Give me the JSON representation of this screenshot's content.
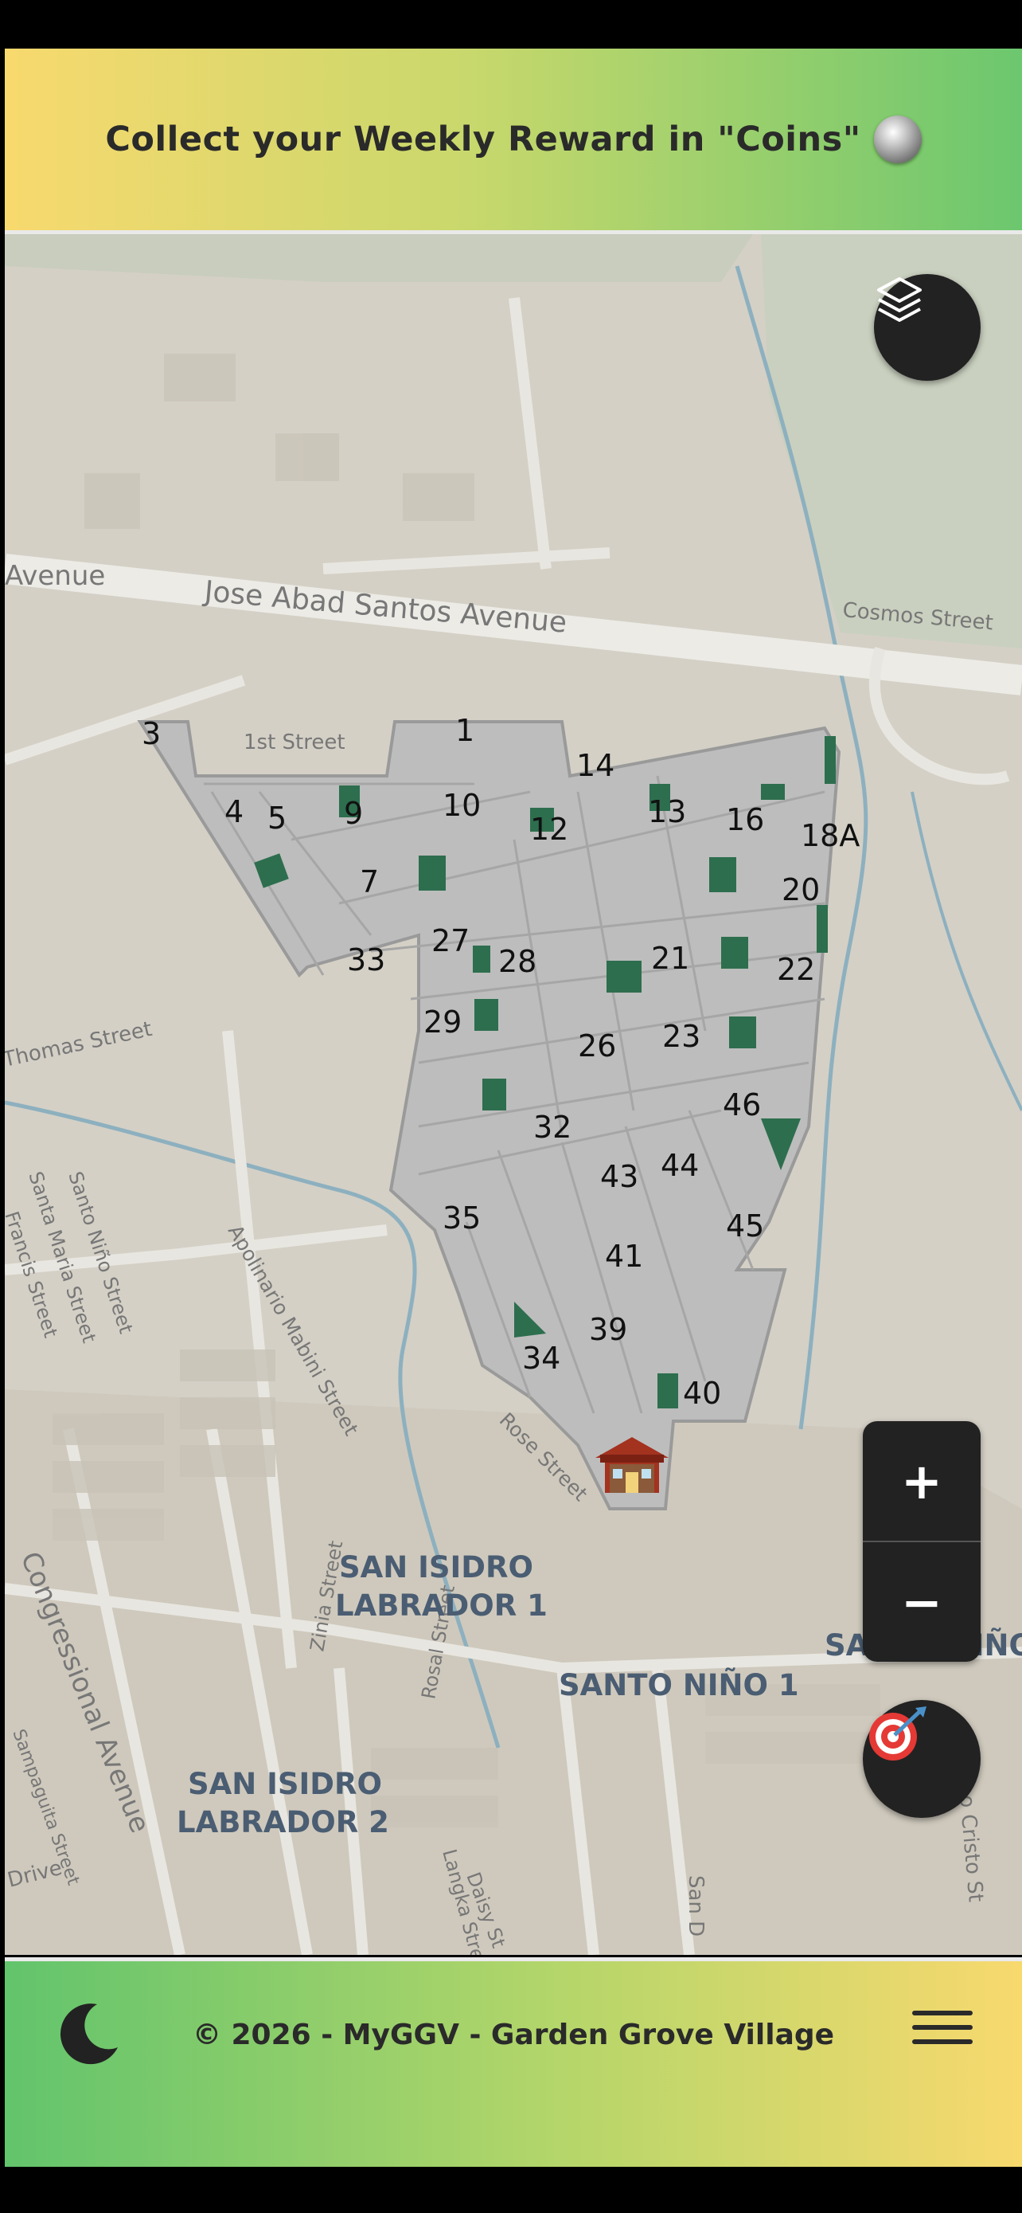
{
  "banner": {
    "text": "Collect your Weekly Reward in \"Coins\"",
    "icon": "coin-icon"
  },
  "map": {
    "roads": [
      {
        "label": "Jose Abad Santos Avenue"
      },
      {
        "label": "Avenue"
      },
      {
        "label": "Cosmos Street"
      },
      {
        "label": "1st Street"
      },
      {
        "label": "Thomas Street"
      },
      {
        "label": "Santo Niño Street"
      },
      {
        "label": "Santa Maria Street"
      },
      {
        "label": "Francis Street"
      },
      {
        "label": "Apolinario Mabini Street"
      },
      {
        "label": "Rose Street"
      },
      {
        "label": "Congressional Avenue"
      },
      {
        "label": "Zinia Street"
      },
      {
        "label": "Rosal Street"
      },
      {
        "label": "Langka Street"
      },
      {
        "label": "Daisy St"
      },
      {
        "label": "Sampaguita Street"
      },
      {
        "label": "San D"
      },
      {
        "label": "o Cristo St"
      },
      {
        "label": "Drive"
      }
    ],
    "places": [
      {
        "line1": "SAN ISIDRO",
        "line2": "LABRADOR 1"
      },
      {
        "line1": "SANTO NIÑO 1",
        "line2": ""
      },
      {
        "line1": "SAN ISIDRO",
        "line2": "LABRADOR 2"
      },
      {
        "line1": "SANTO NIÑO",
        "line2": ""
      }
    ],
    "lots": [
      "3",
      "1",
      "14",
      "4",
      "5",
      "9",
      "10",
      "12",
      "13",
      "16",
      "18A",
      "7",
      "20",
      "27",
      "33",
      "28",
      "21",
      "22",
      "29",
      "26",
      "23",
      "32",
      "46",
      "43",
      "44",
      "35",
      "45",
      "41",
      "39",
      "34",
      "40"
    ],
    "entrance_icon": "house-icon"
  },
  "controls": {
    "layers_icon": "layers-icon",
    "zoom_in": "+",
    "zoom_out": "−",
    "locate_icon": "target-icon"
  },
  "footer": {
    "copyright": "© 2026 - MyGGV - Garden Grove Village",
    "theme_icon": "moon-icon",
    "menu_icon": "hamburger-icon"
  },
  "colors": {
    "banner_start": "#f8d96e",
    "banner_end": "#6cc76e",
    "lot_fill": "#c4c4c4",
    "lot_highlight": "#2d6e4e",
    "control_bg": "#222222"
  }
}
